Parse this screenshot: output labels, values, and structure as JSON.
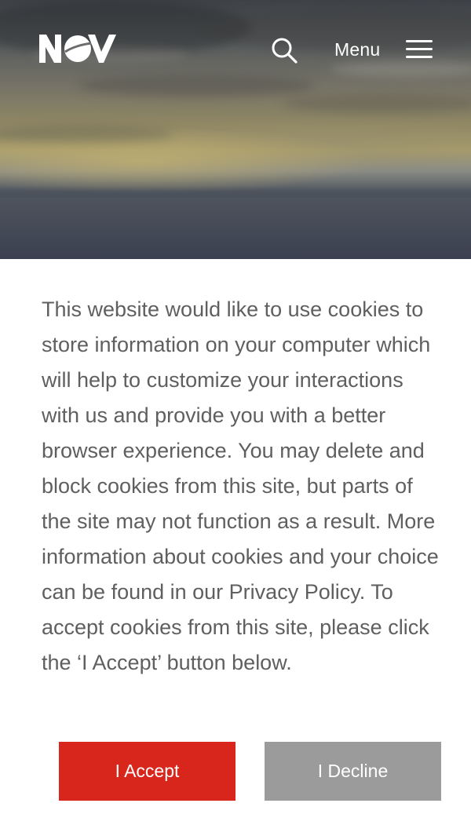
{
  "header": {
    "logo_alt": "NOV",
    "search_icon": "search-icon",
    "menu_label": "Menu",
    "menu_icon": "hamburger-icon"
  },
  "cookie_banner": {
    "message": "This website would like to use cookies to store information on your computer which will help to customize your interactions with us and provide you with a better browser experience. You may delete and block cookies from this site, but parts of the site may not function as a result. More information about cookies and your choice can be found in our Privacy Policy. To accept cookies from this site, please click the ‘I Accept’ button below.",
    "accept_label": "I Accept",
    "decline_label": "I Decline"
  },
  "colors": {
    "accept": "#d9261c",
    "decline": "#9b9b9b",
    "text": "#5f5f5f"
  }
}
